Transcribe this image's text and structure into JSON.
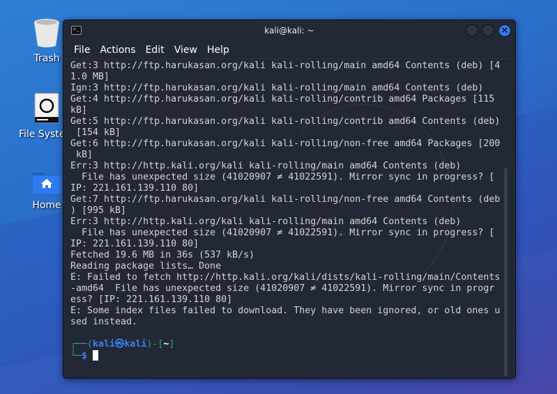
{
  "desktop": {
    "icons": [
      {
        "label": "Trash",
        "icon": "trash-icon"
      },
      {
        "label": "File System",
        "icon": "drive-icon"
      },
      {
        "label": "Home",
        "icon": "home-folder-icon"
      }
    ]
  },
  "window": {
    "title": "kali@kali: ~",
    "menu": [
      "File",
      "Actions",
      "Edit",
      "View",
      "Help"
    ],
    "close_glyph": "✕"
  },
  "terminal": {
    "lines": [
      "Get:3 http://ftp.harukasan.org/kali kali-rolling/main amd64 Contents (deb) [4",
      "1.0 MB]",
      "Ign:3 http://ftp.harukasan.org/kali kali-rolling/main amd64 Contents (deb)",
      "Get:4 http://ftp.harukasan.org/kali kali-rolling/contrib amd64 Packages [115",
      "kB]",
      "Get:5 http://ftp.harukasan.org/kali kali-rolling/contrib amd64 Contents (deb)",
      " [154 kB]",
      "Get:6 http://ftp.harukasan.org/kali kali-rolling/non-free amd64 Packages [200",
      " kB]",
      "Err:3 http://http.kali.org/kali kali-rolling/main amd64 Contents (deb)",
      "  File has unexpected size (41020907 ≠ 41022591). Mirror sync in progress? [",
      "IP: 221.161.139.110 80]",
      "Get:7 http://ftp.harukasan.org/kali kali-rolling/non-free amd64 Contents (deb",
      ") [995 kB]",
      "Err:3 http://http.kali.org/kali kali-rolling/main amd64 Contents (deb)",
      "  File has unexpected size (41020907 ≠ 41022591). Mirror sync in progress? [",
      "IP: 221.161.139.110 80]",
      "Fetched 19.6 MB in 36s (537 kB/s)",
      "Reading package lists… Done",
      "E: Failed to fetch http://http.kali.org/kali/dists/kali-rolling/main/Contents",
      "-amd64  File has unexpected size (41020907 ≠ 41022591). Mirror sync in progr",
      "ess? [IP: 221.161.139.110 80]",
      "E: Some index files failed to download. They have been ignored, or old ones u",
      "sed instead.",
      ""
    ],
    "prompt": {
      "open": "┌──(",
      "user": "kali㉿kali",
      "close": ")-[",
      "dir": "~",
      "end": "]",
      "second": "└─",
      "dollar": "$"
    }
  }
}
